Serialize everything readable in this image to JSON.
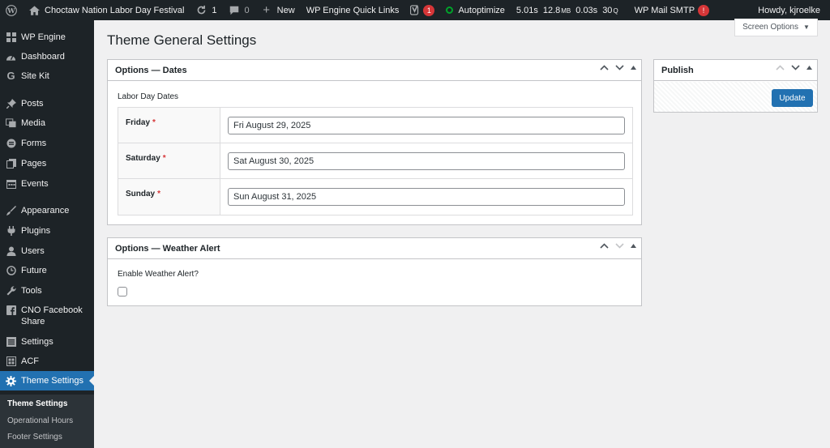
{
  "adminbar": {
    "site_name": "Choctaw Nation Labor Day Festival",
    "updates_count": "1",
    "comments_count": "0",
    "new_label": "New",
    "quick_links": "WP Engine Quick Links",
    "yoast_badge": "1",
    "autoptimize": "Autoptimize",
    "perf": {
      "time": "5.01s",
      "mem": "12.8",
      "mem_unit": "MB",
      "db_time": "0.03s",
      "queries": "30",
      "queries_unit": "Q"
    },
    "smtp": "WP Mail SMTP",
    "howdy": "Howdy, kjroelke",
    "colors": {
      "bg": "#1d2327",
      "alert": "#d63638",
      "ok": "#00a32a"
    }
  },
  "sidebar": {
    "items": [
      {
        "label": "WP Engine",
        "icon": "grid-icon"
      },
      {
        "label": "Dashboard",
        "icon": "dashboard-icon"
      },
      {
        "label": "Site Kit",
        "icon": "google-g-icon"
      },
      {
        "label": "Posts",
        "icon": "pushpin-icon"
      },
      {
        "label": "Media",
        "icon": "media-icon"
      },
      {
        "label": "Forms",
        "icon": "forms-icon"
      },
      {
        "label": "Pages",
        "icon": "pages-icon"
      },
      {
        "label": "Events",
        "icon": "calendar-icon"
      },
      {
        "label": "Appearance",
        "icon": "paintbrush-icon"
      },
      {
        "label": "Plugins",
        "icon": "plug-icon"
      },
      {
        "label": "Users",
        "icon": "user-icon"
      },
      {
        "label": "Future",
        "icon": "clock-icon"
      },
      {
        "label": "Tools",
        "icon": "wrench-icon"
      },
      {
        "label": "CNO Facebook",
        "label2": "Share",
        "icon": "facebook-icon"
      },
      {
        "label": "Settings",
        "icon": "settings-icon"
      },
      {
        "label": "ACF",
        "icon": "acf-icon"
      },
      {
        "label": "Theme Settings",
        "icon": "gear-icon"
      }
    ],
    "submenu": [
      "Theme Settings",
      "Operational Hours",
      "Footer Settings"
    ],
    "accent": "#2271b1"
  },
  "main": {
    "title": "Theme General Settings",
    "screen_options": "Screen Options",
    "dates_box": {
      "title": "Options — Dates",
      "field_label": "Labor Day Dates",
      "rows": [
        {
          "label": "Friday",
          "required": "*",
          "value": "Fri August 29, 2025"
        },
        {
          "label": "Saturday",
          "required": "*",
          "value": "Sat August 30, 2025"
        },
        {
          "label": "Sunday",
          "required": "*",
          "value": "Sun August 31, 2025"
        }
      ]
    },
    "weather_box": {
      "title": "Options — Weather Alert",
      "field_label": "Enable Weather Alert?",
      "checked": false
    },
    "publish_box": {
      "title": "Publish",
      "update_label": "Update"
    }
  }
}
